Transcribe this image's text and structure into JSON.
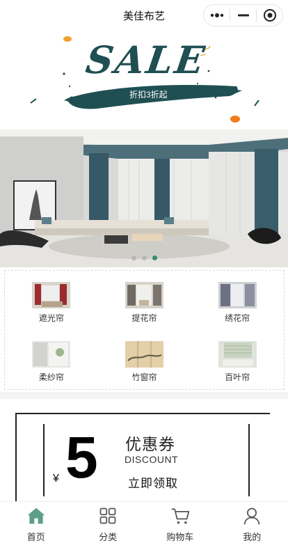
{
  "nav": {
    "title": "美佳布艺"
  },
  "sale_banner": {
    "headline": "SALE",
    "sub": "折扣3折起"
  },
  "carousel": {
    "slide_count": 3,
    "active_index": 2,
    "accent": "#3d8a6e"
  },
  "categories": [
    {
      "label": "遮光帘"
    },
    {
      "label": "提花帘"
    },
    {
      "label": "绣花帘"
    },
    {
      "label": "柔纱帘"
    },
    {
      "label": "竹窗帘"
    },
    {
      "label": "百叶帘"
    }
  ],
  "coupon": {
    "currency": "¥",
    "amount": "5",
    "title": "优惠券",
    "subtitle": "DISCOUNT",
    "claim_label": "立即领取"
  },
  "tabbar": {
    "active_color": "#5a9f86",
    "items": [
      {
        "label": "首页",
        "icon": "home-icon",
        "active": true
      },
      {
        "label": "分类",
        "icon": "grid-icon",
        "active": false
      },
      {
        "label": "购物车",
        "icon": "cart-icon",
        "active": false
      },
      {
        "label": "我的",
        "icon": "user-icon",
        "active": false
      }
    ]
  }
}
